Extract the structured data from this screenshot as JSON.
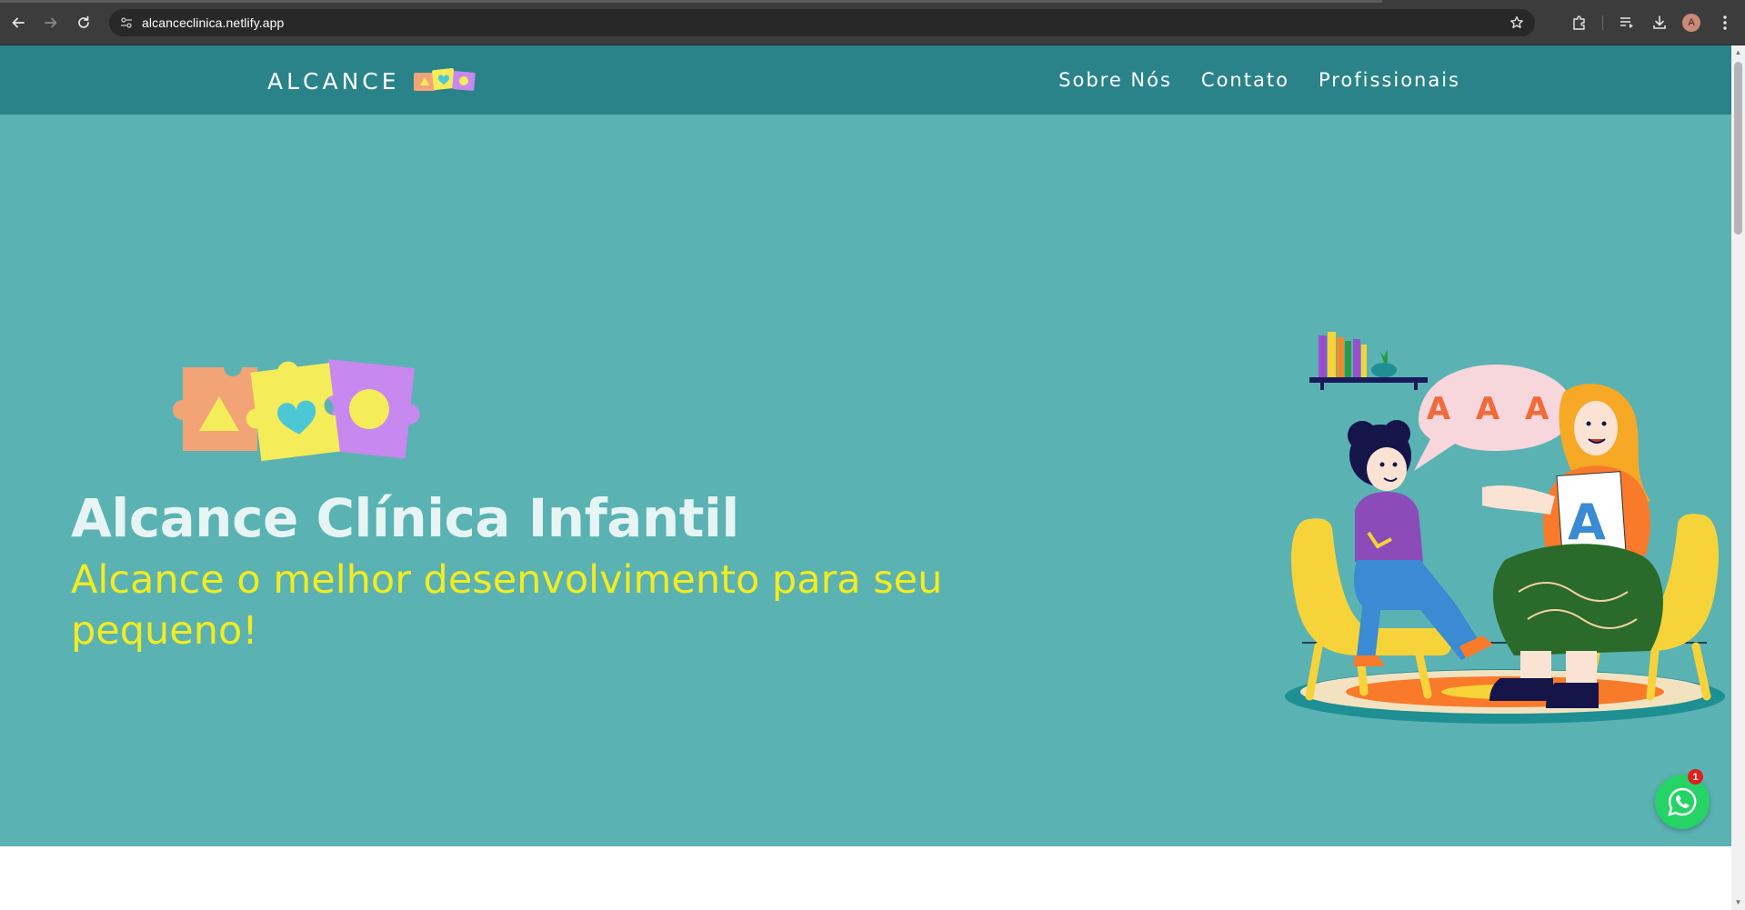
{
  "browser": {
    "url": "alcanceclinica.netlify.app",
    "avatar_initial": "A"
  },
  "header": {
    "brand": "ALCANCE",
    "nav": [
      {
        "label": "Sobre Nós"
      },
      {
        "label": "Contato"
      },
      {
        "label": "Profissionais"
      }
    ]
  },
  "hero": {
    "title": "Alcance Clínica Infantil",
    "subtitle": "Alcance o melhor desenvolvimento para seu pequeno!",
    "speech_bubble_text": "A A A",
    "card_letter": "A"
  },
  "whatsapp": {
    "badge_count": "1"
  },
  "colors": {
    "header_bg": "#2a8389",
    "hero_bg": "#5bb2b3",
    "title": "#e6f5f4",
    "subtitle": "#f2ec20",
    "whatsapp": "#25d366",
    "puzzle_orange": "#f2a476",
    "puzzle_yellow": "#f5ec5a",
    "puzzle_purple": "#c788f0"
  }
}
